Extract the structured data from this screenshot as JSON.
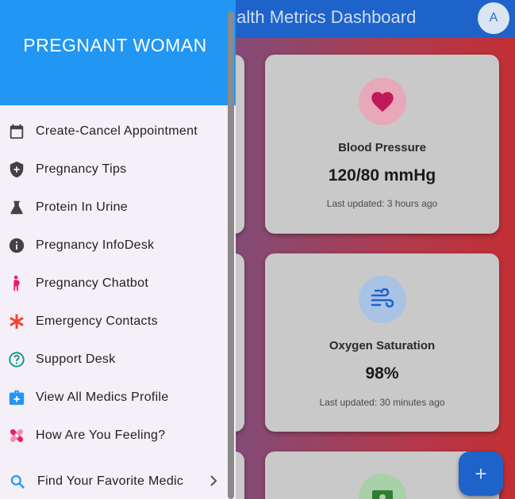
{
  "app": {
    "title": "Health Metrics Dashboard",
    "avatar_initial": "A"
  },
  "cards": [
    {
      "label": "Blood Pressure",
      "value": "120/80 mmHg",
      "updated": "Last updated: 3 hours ago",
      "icon": "heart-icon",
      "icon_color": "#c2185b"
    },
    {
      "label": "Oxygen Saturation",
      "value": "98%",
      "updated": "Last updated: 30 minutes ago",
      "icon": "air-icon",
      "icon_color": "#1e63c9"
    },
    {
      "label": "",
      "value": "",
      "updated": "",
      "icon": "money-icon",
      "icon_color": "#2e7d32"
    }
  ],
  "fab": {
    "icon": "add-icon"
  },
  "drawer": {
    "header_title": "PREGNANT WOMAN",
    "header_color": "#2196f3",
    "items": [
      {
        "label": "Create-Cancel Appointment",
        "icon": "calendar-icon"
      },
      {
        "label": "Pregnancy Tips",
        "icon": "shield-plus-icon"
      },
      {
        "label": "Protein In Urine",
        "icon": "flask-icon"
      },
      {
        "label": "Pregnancy InfoDesk",
        "icon": "info-icon"
      },
      {
        "label": "Pregnancy Chatbot",
        "icon": "pregnant-woman-icon"
      },
      {
        "label": "Emergency Contacts",
        "icon": "asterisk-icon"
      },
      {
        "label": "Support Desk",
        "icon": "help-circle-icon"
      },
      {
        "label": "View All Medics Profile",
        "icon": "medical-bag-icon"
      },
      {
        "label": "How Are You Feeling?",
        "icon": "bandage-icon"
      }
    ],
    "expandable": {
      "label": "Find Your Favorite Medic",
      "icon": "search-icon"
    }
  }
}
